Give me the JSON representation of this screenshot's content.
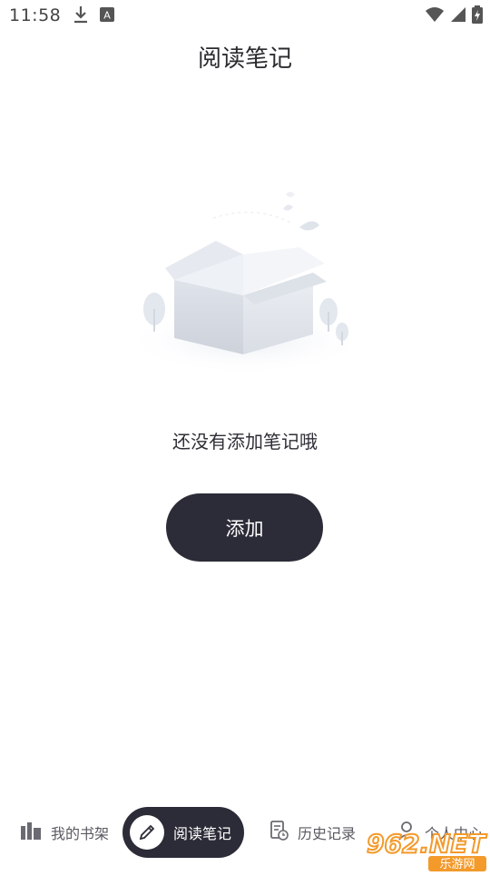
{
  "status": {
    "time": "11:58"
  },
  "page": {
    "title": "阅读笔记"
  },
  "empty_state": {
    "message": "还没有添加笔记哦",
    "add_button_label": "添加"
  },
  "nav": {
    "items": [
      {
        "label": "我的书架",
        "icon": "bookshelf-icon",
        "active": false
      },
      {
        "label": "阅读笔记",
        "icon": "pencil-icon",
        "active": true
      },
      {
        "label": "历史记录",
        "icon": "history-icon",
        "active": false
      },
      {
        "label": "个人中心",
        "icon": "user-icon",
        "active": false
      }
    ]
  },
  "watermark": {
    "line1": "962.NET",
    "line2": "乐游网"
  },
  "colors": {
    "accent_dark": "#2c2c38",
    "background": "#ffffff",
    "watermark_orange": "#f39a2b"
  }
}
